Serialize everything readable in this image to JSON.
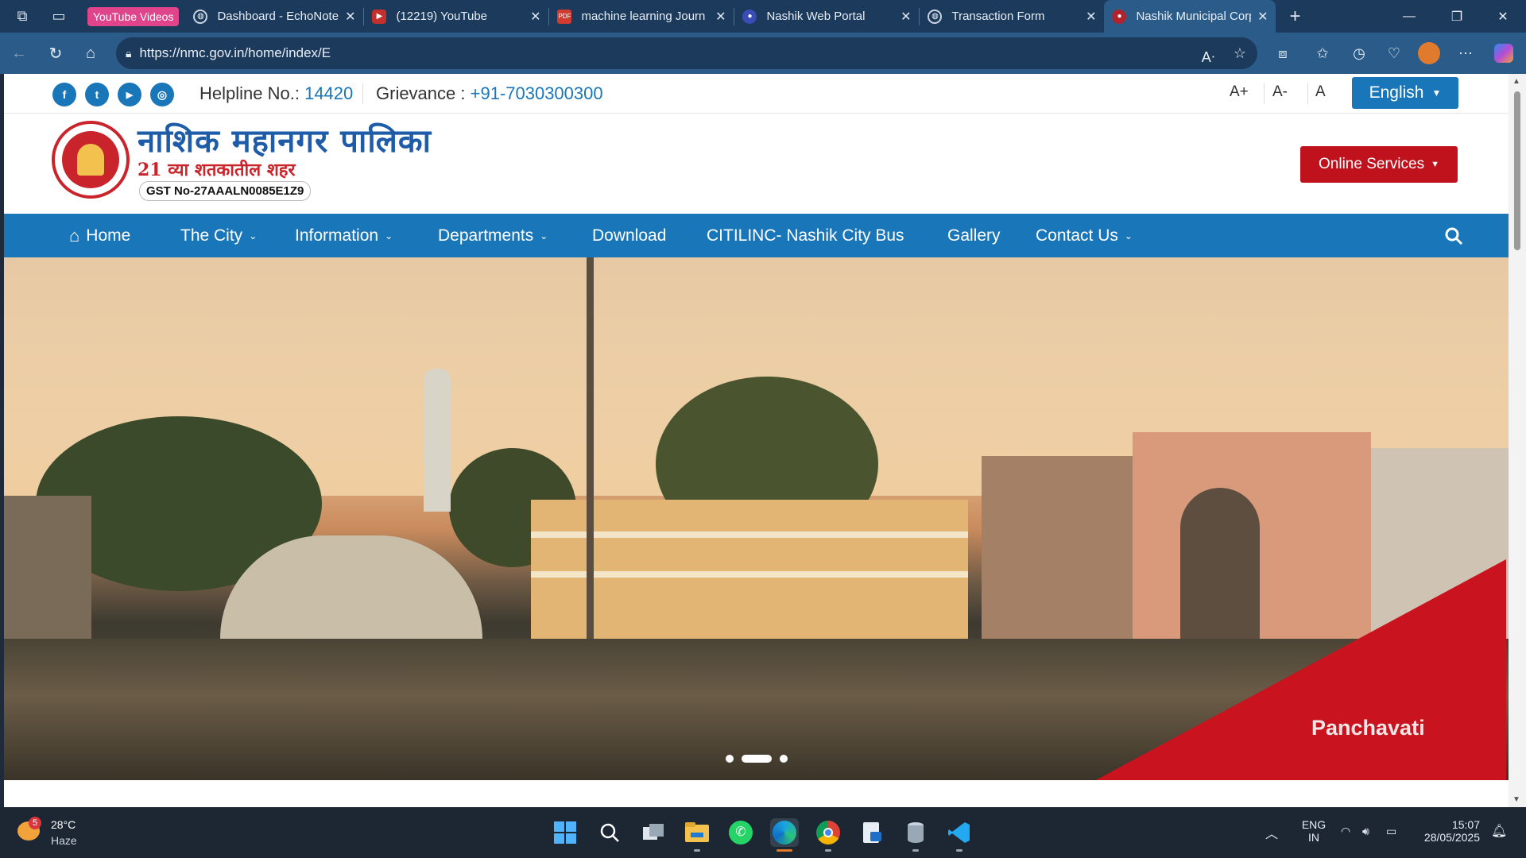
{
  "browser": {
    "yt_chip": "YouTube Videos",
    "tabs": [
      {
        "title": "Dashboard - EchoNote",
        "fav": "globe",
        "color": "#5a6d82"
      },
      {
        "title": "(12219) YouTube",
        "fav": "youtube",
        "color": "#c4302b"
      },
      {
        "title": "machine learning Journ",
        "fav": "pdf",
        "color": "#d23b2f"
      },
      {
        "title": "Nashik Web Portal",
        "fav": "portal",
        "color": "#3a4cb5"
      },
      {
        "title": "Transaction Form",
        "fav": "globe",
        "color": "#5a6d82"
      },
      {
        "title": "Nashik Municipal Corpc",
        "fav": "nmc",
        "color": "#b2222c"
      }
    ],
    "url": "https://nmc.gov.in/home/index/E"
  },
  "topbar": {
    "social": [
      "f",
      "t",
      "▶",
      "◎"
    ],
    "helpline_label": "Helpline No.: ",
    "helpline_num": "14420",
    "grievance_label": "Grievance : ",
    "grievance_num": "+91-7030300300",
    "font_up": "A+",
    "font_down": "A-",
    "font_reset": "A",
    "language": "English"
  },
  "header": {
    "title": "नाशिक महानगर पालिका",
    "tagline": "21 व्या शतकातील शहर",
    "gst": "GST No-27AAALN0085E1Z9",
    "online_services": "Online Services"
  },
  "nav": {
    "items": [
      {
        "label": "Home"
      },
      {
        "label": "The City"
      },
      {
        "label": "Information"
      },
      {
        "label": "Departments"
      },
      {
        "label": "Download"
      },
      {
        "label": "CITILINC- Nashik City Bus"
      },
      {
        "label": "Gallery"
      },
      {
        "label": "Contact Us"
      }
    ]
  },
  "hero": {
    "caption": "Panchavati",
    "slides": 3,
    "active_slide": 2
  },
  "taskbar": {
    "weather_temp": "28°C",
    "weather_desc": "Haze",
    "weather_badge": "5",
    "lang1": "ENG",
    "lang2": "IN",
    "time": "15:07",
    "date": "28/05/2025"
  }
}
